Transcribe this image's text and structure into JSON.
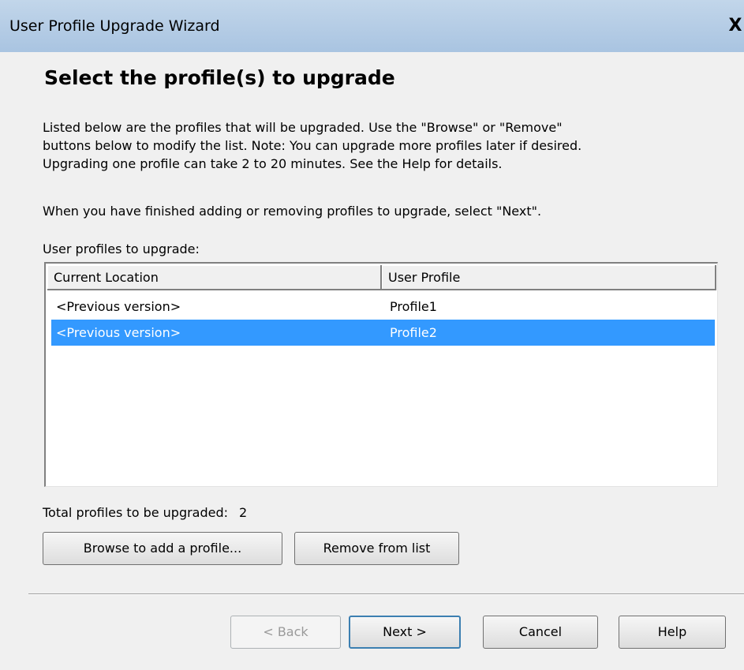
{
  "window": {
    "title": "User Profile Upgrade Wizard",
    "close_glyph": "X"
  },
  "page": {
    "heading": "Select the profile(s) to upgrade",
    "description_lines": [
      "Listed below are the profiles that will be upgraded. Use the \"Browse\" or \"Remove\"",
      "buttons below to modify the list. Note: You can upgrade more profiles later if desired.",
      "Upgrading one profile can take 2 to 20 minutes. See the Help for details."
    ],
    "instruction": "When you have finished adding or removing profiles to upgrade, select \"Next\".",
    "list_label": "User profiles to upgrade:"
  },
  "profile_list": {
    "columns": [
      "Current Location",
      "User Profile"
    ],
    "rows": [
      {
        "location": "<Previous version>",
        "profile": "Profile1",
        "selected": false
      },
      {
        "location": "<Previous version>",
        "profile": "Profile2",
        "selected": true
      }
    ],
    "selection_color": "#3399ff"
  },
  "summary": {
    "total_label": "Total profiles to be upgraded:",
    "total_count": "2"
  },
  "actions": {
    "browse_label": "Browse to add a profile...",
    "remove_label": "Remove from list"
  },
  "navigation": {
    "back_label": "< Back",
    "back_enabled": false,
    "next_label": "Next >",
    "cancel_label": "Cancel",
    "help_label": "Help"
  }
}
